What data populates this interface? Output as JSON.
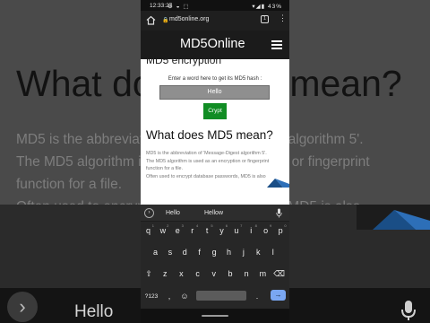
{
  "status_bar": {
    "time": "12:33:27",
    "status_icons": "⚙ ◒ ⬚",
    "right": "▾◢▮ 43%"
  },
  "browser": {
    "url": "md5online.org",
    "tab_count": "1",
    "menu": "⋮"
  },
  "site": {
    "logo": "MD5Online"
  },
  "content": {
    "cut_heading": "MD5 encryption",
    "enter_label": "Enter a word here to get its MD5 hash :",
    "input_value": "Hello",
    "crypt_label": "Crypt",
    "section_title": "What does MD5 mean?",
    "body_lines": [
      "MD5 is the abbreviation of 'Message-Digest algorithm 5'.",
      "The MD5 algorithm is used as an encryption or fingerprint",
      "function for a file.",
      "Often used to encrypt database passwords, MD5 is also"
    ]
  },
  "background": {
    "title": "What does MD5 mean?",
    "lines": [
      "MD5 is the abbreviation of 'Message-Digest algorithm 5'.",
      "The MD5 algorithm is used as an encryption or fingerprint",
      "function for a file.",
      "Often used to encrypt database passwords, MD5 is also"
    ],
    "input_text": "Hello",
    "arrow": "›"
  },
  "keyboard": {
    "suggestions": [
      "Hello",
      "Hellow"
    ],
    "suggestion_arrow": "›",
    "row1": [
      {
        "k": "q",
        "h": "1"
      },
      {
        "k": "w",
        "h": "2"
      },
      {
        "k": "e",
        "h": "3"
      },
      {
        "k": "r",
        "h": "4"
      },
      {
        "k": "t",
        "h": "5"
      },
      {
        "k": "y",
        "h": "6"
      },
      {
        "k": "u",
        "h": "7"
      },
      {
        "k": "i",
        "h": "8"
      },
      {
        "k": "o",
        "h": "9"
      },
      {
        "k": "p",
        "h": "0"
      }
    ],
    "row2": [
      "a",
      "s",
      "d",
      "f",
      "g",
      "h",
      "j",
      "k",
      "l"
    ],
    "row3": [
      "⇧",
      "z",
      "x",
      "c",
      "v",
      "b",
      "n",
      "m",
      "⌫"
    ],
    "row4": {
      "symbols": "?123",
      "comma": ",",
      "emoji": "☺",
      "period": ".",
      "enter": "→"
    }
  }
}
